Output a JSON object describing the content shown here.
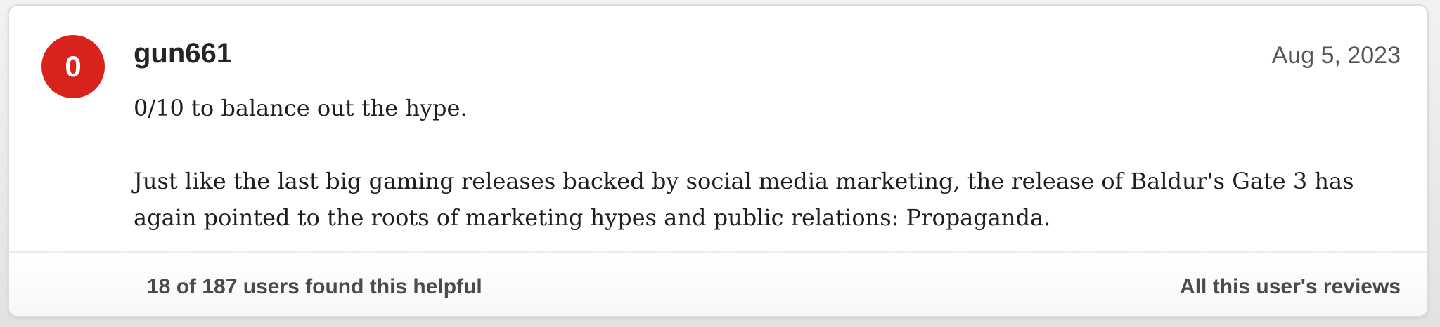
{
  "review": {
    "score": "0",
    "username": "gun661",
    "date": "Aug 5, 2023",
    "body": [
      "0/10 to balance out the hype.",
      "Just like the last big gaming releases backed by social media marketing, the release of Baldur's Gate 3 has again pointed to the roots of marketing hypes and public relations: Propaganda."
    ],
    "helpful_text": "18 of 187 users found this helpful",
    "all_reviews_link": "All this user's reviews"
  },
  "colors": {
    "score_negative": "#d8231c",
    "card_background": "#ffffff",
    "text_primary": "#262626",
    "text_secondary": "#4a4a4a"
  }
}
